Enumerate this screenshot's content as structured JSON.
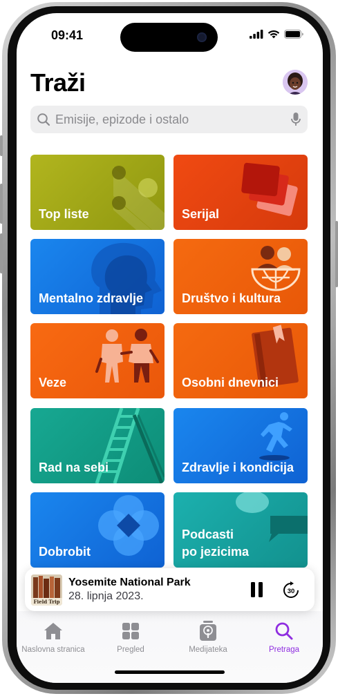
{
  "status_bar": {
    "time": "09:41"
  },
  "header": {
    "title": "Traži"
  },
  "search": {
    "placeholder": "Emisije, epizode i ostalo"
  },
  "categories": [
    {
      "label": "Top liste",
      "color": "#9aa012"
    },
    {
      "label": "Serijal",
      "color": "#e94a10"
    },
    {
      "label": "Mentalno zdravlje",
      "color": "#1677e6"
    },
    {
      "label": "Društvo i kultura",
      "color": "#f0620a"
    },
    {
      "label": "Veze",
      "color": "#f0620a"
    },
    {
      "label": "Osobni dnevnici",
      "color": "#f0620a"
    },
    {
      "label": "Rad na sebi",
      "color": "#14a08a"
    },
    {
      "label": "Zdravlje i kondicija",
      "color": "#1677e6"
    },
    {
      "label": "Dobrobit",
      "color": "#1677e6"
    },
    {
      "label": "Podcasti\npo jezicima",
      "color": "#1aa9a6"
    }
  ],
  "now_playing": {
    "title": "Yosemite National Park",
    "date": "28. lipnja 2023.",
    "cover_text": "Field Trip"
  },
  "tabs": [
    {
      "label": "Naslovna stranica",
      "icon": "home-icon",
      "active": false
    },
    {
      "label": "Pregled",
      "icon": "grid-icon",
      "active": false
    },
    {
      "label": "Medijateka",
      "icon": "library-icon",
      "active": false
    },
    {
      "label": "Pretraga",
      "icon": "search-icon",
      "active": true
    }
  ],
  "colors": {
    "accent": "#8f2de0"
  }
}
